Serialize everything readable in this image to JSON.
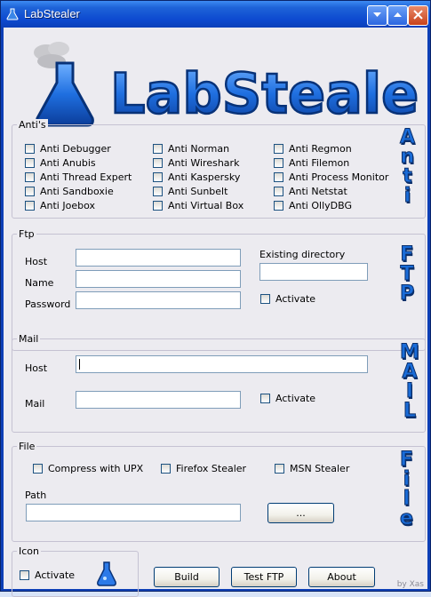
{
  "window": {
    "title": "LabStealer"
  },
  "logo": {
    "text": "LabStealer"
  },
  "antis": {
    "legend": "Anti's",
    "side_word": [
      "A",
      "n",
      "t",
      "i"
    ],
    "col1": [
      "Anti Debugger",
      "Anti Anubis",
      "Anti Thread Expert",
      "Anti Sandboxie",
      "Anti Joebox"
    ],
    "col2": [
      "Anti Norman",
      "Anti Wireshark",
      "Anti Kaspersky",
      "Anti Sunbelt",
      "Anti Virtual Box"
    ],
    "col3": [
      "Anti Regmon",
      "Anti Filemon",
      "Anti Process Monitor",
      "Anti Netstat",
      "Anti OllyDBG"
    ]
  },
  "ftp": {
    "legend": "Ftp",
    "host_label": "Host",
    "name_label": "Name",
    "password_label": "Password",
    "existing_dir_label": "Existing directory",
    "activate_label": "Activate",
    "side_word": [
      "F",
      "T",
      "P"
    ]
  },
  "mail": {
    "legend": "Mail",
    "host_label": "Host",
    "mail_label": "Mail",
    "activate_label": "Activate",
    "side_word": [
      "M",
      "A",
      "I",
      "L"
    ]
  },
  "file": {
    "legend": "File",
    "compress_label": "Compress with UPX",
    "firefox_label": "Firefox Stealer",
    "msn_label": "MSN Stealer",
    "path_label": "Path",
    "browse_label": "...",
    "side_word": [
      "F",
      "i",
      "l",
      "e"
    ]
  },
  "icon": {
    "legend": "Icon",
    "activate_label": "Activate"
  },
  "buttons": {
    "build": "Build",
    "test_ftp": "Test FTP",
    "about": "About"
  },
  "credit": "by Xas",
  "colors": {
    "titlebar": "#0d4ad0",
    "accent": "#1a6cd8",
    "background": "#ecebf0"
  }
}
